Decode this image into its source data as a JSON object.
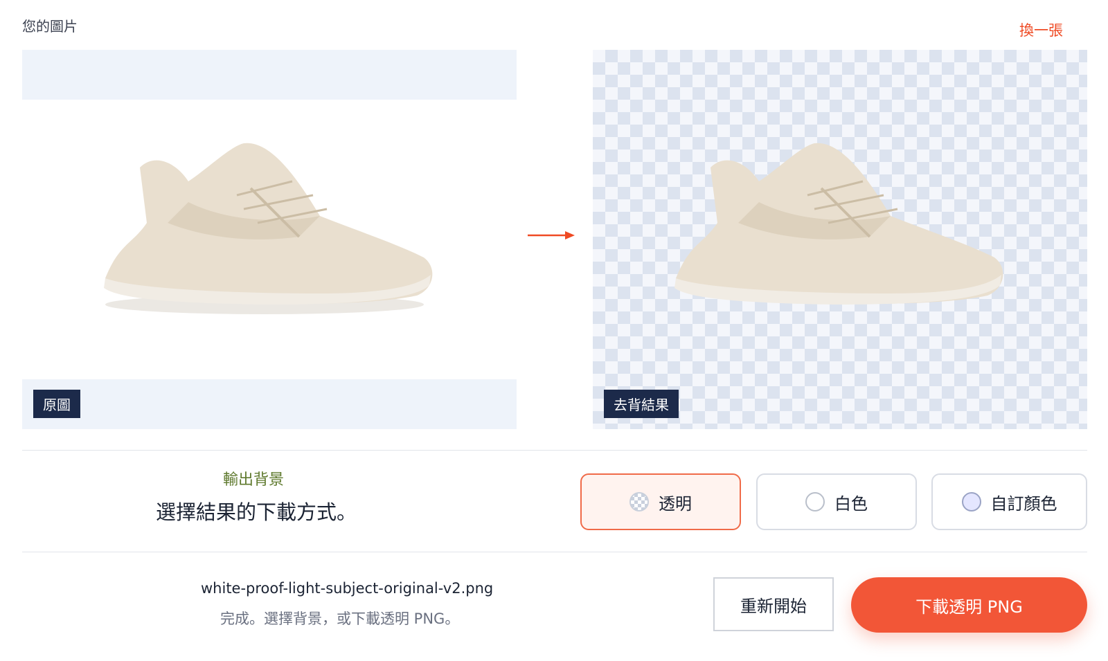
{
  "header": {
    "section_label": "您的圖片",
    "replace_label": "換一張"
  },
  "preview": {
    "original_tag": "原圖",
    "result_tag": "去背結果"
  },
  "background_options": {
    "eyebrow": "輸出背景",
    "title": "選擇結果的下載方式。",
    "options": [
      {
        "label": "透明",
        "icon": "checker-swatch-icon",
        "selected": true
      },
      {
        "label": "白色",
        "icon": "white-swatch-icon",
        "selected": false
      },
      {
        "label": "自訂顏色",
        "icon": "custom-color-swatch-icon",
        "selected": false
      }
    ]
  },
  "footer": {
    "file_name": "white-proof-light-subject-original-v2.png",
    "status": "完成。選擇背景，或下載透明 PNG。",
    "restart_label": "重新開始",
    "download_label": "下載透明 PNG"
  },
  "colors": {
    "accent": "#f25637",
    "tag_bg": "#1c2a4a",
    "eyebrow": "#5f7a2e",
    "selected_border": "#f06a48"
  }
}
